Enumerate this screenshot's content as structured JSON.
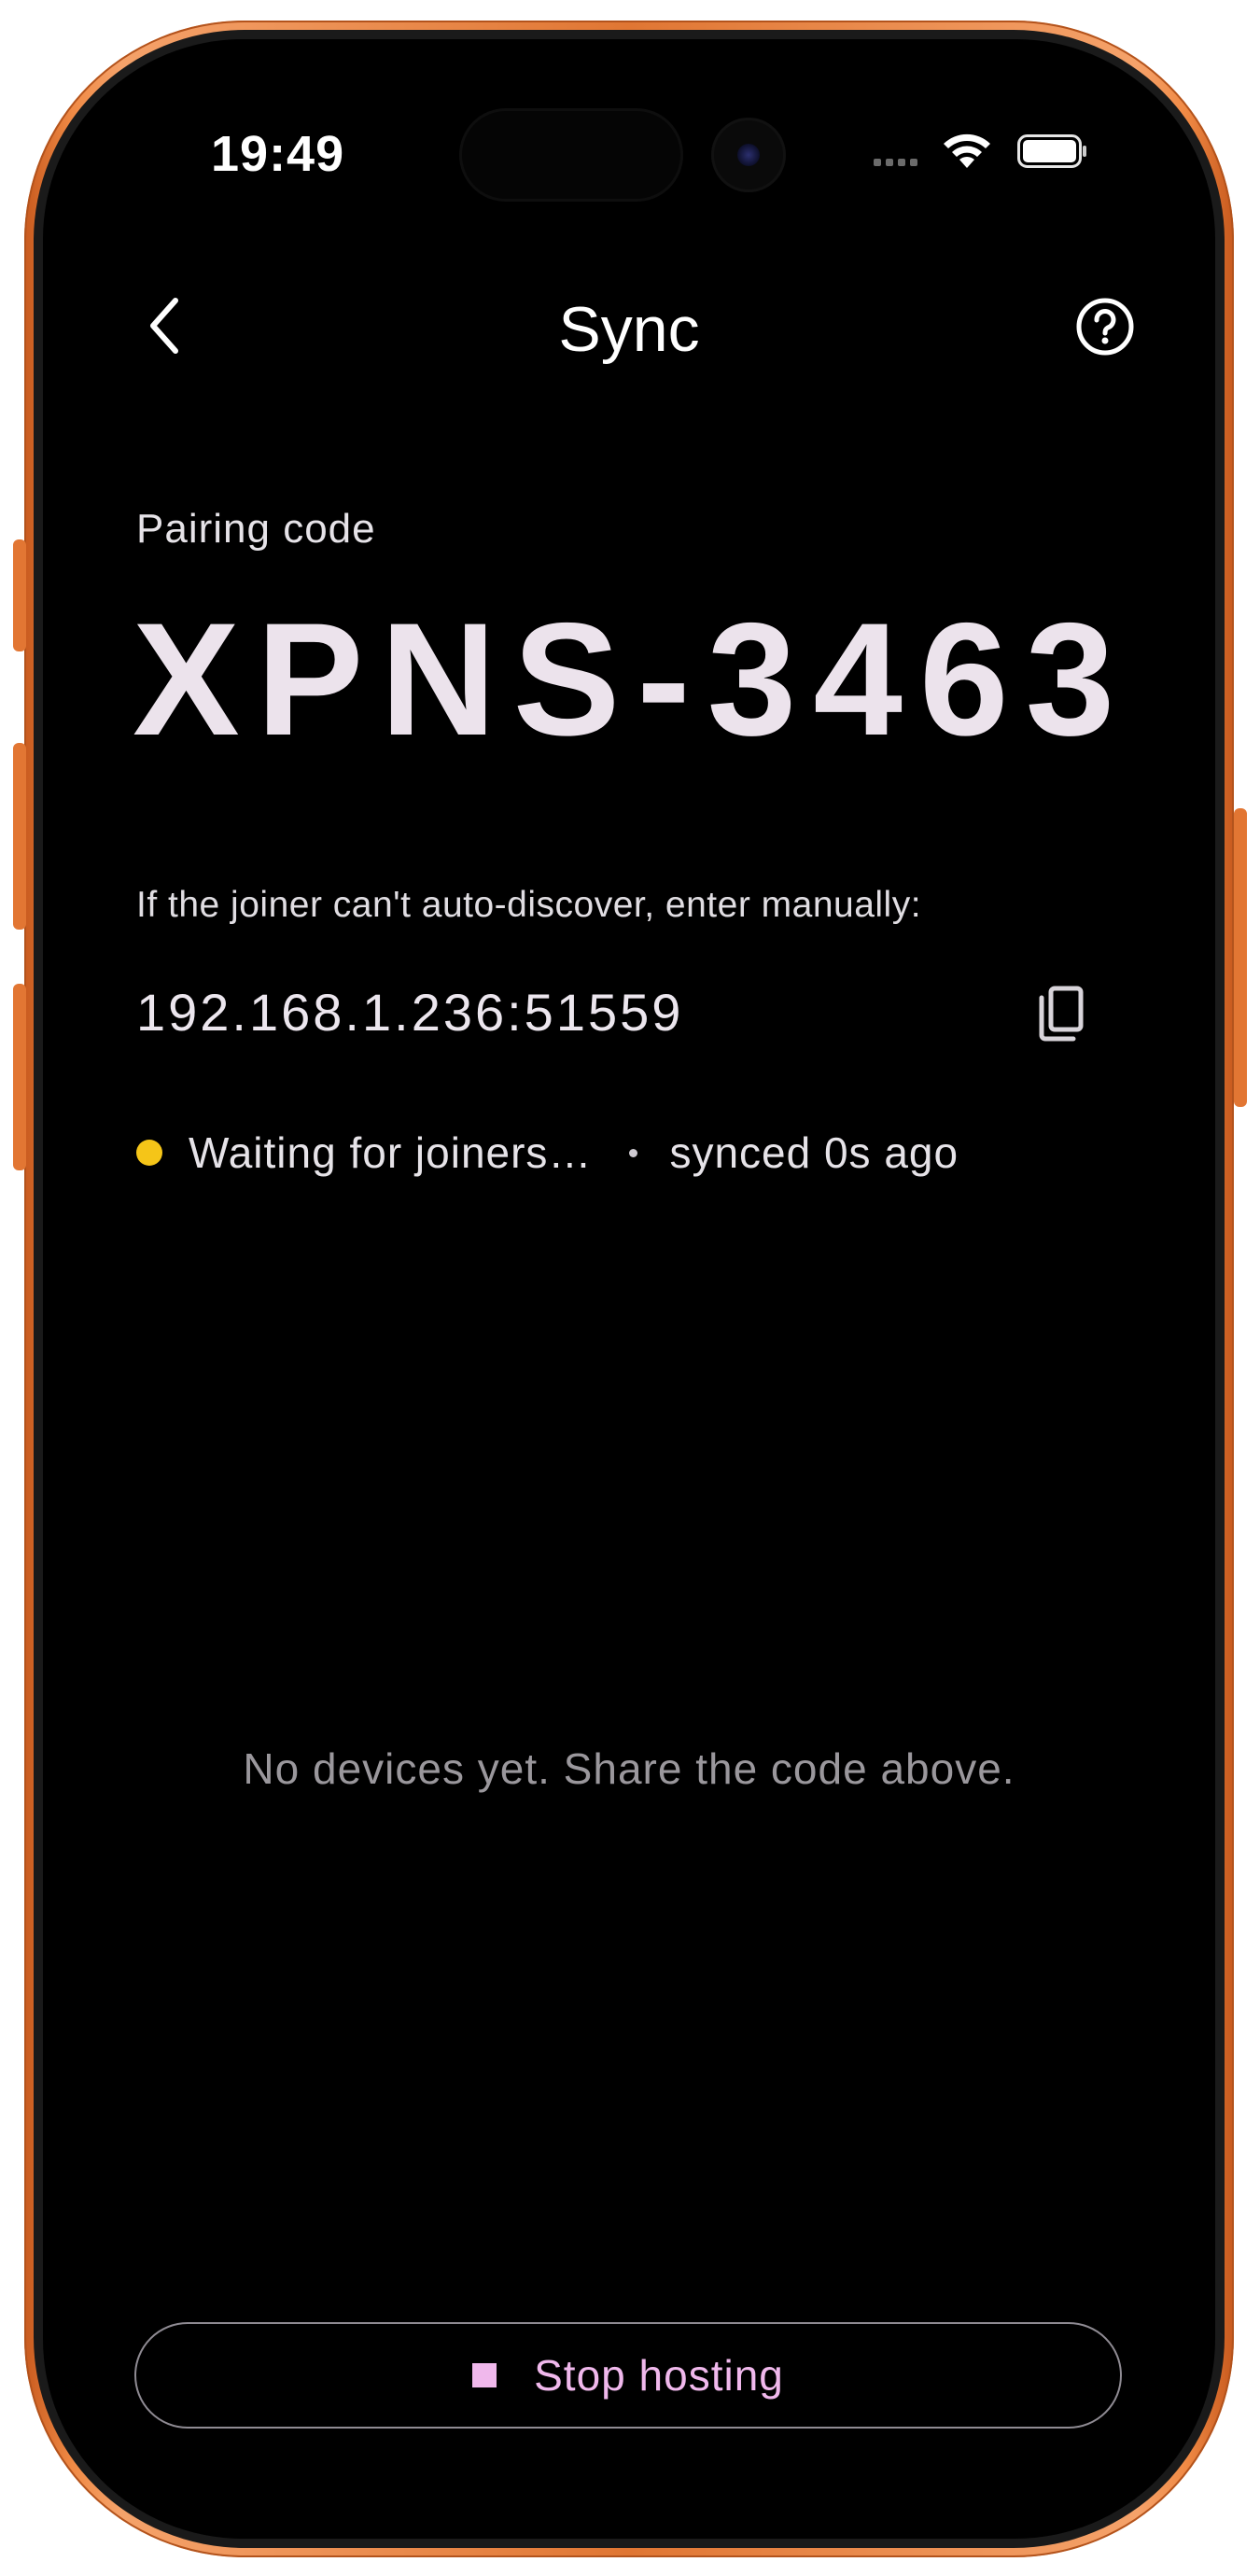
{
  "status_bar": {
    "time": "19:49"
  },
  "header": {
    "title": "Sync",
    "back_icon": "chevron-left-icon",
    "help_icon": "help-circle-icon"
  },
  "pairing": {
    "label": "Pairing code",
    "code": "XPNS-3463"
  },
  "manual": {
    "hint": "If the joiner can't auto-discover, enter manually:",
    "address": "192.168.1.236:51559",
    "copy_icon": "copy-icon"
  },
  "status": {
    "state_text": "Waiting for joiners…",
    "synced_text": "synced 0s ago",
    "dot_color": "#f5c518"
  },
  "devices": {
    "empty_message": "No devices yet. Share the code above."
  },
  "actions": {
    "stop_label": "Stop hosting",
    "stop_icon": "stop-square-icon",
    "accent_color": "#f0b8ec"
  }
}
